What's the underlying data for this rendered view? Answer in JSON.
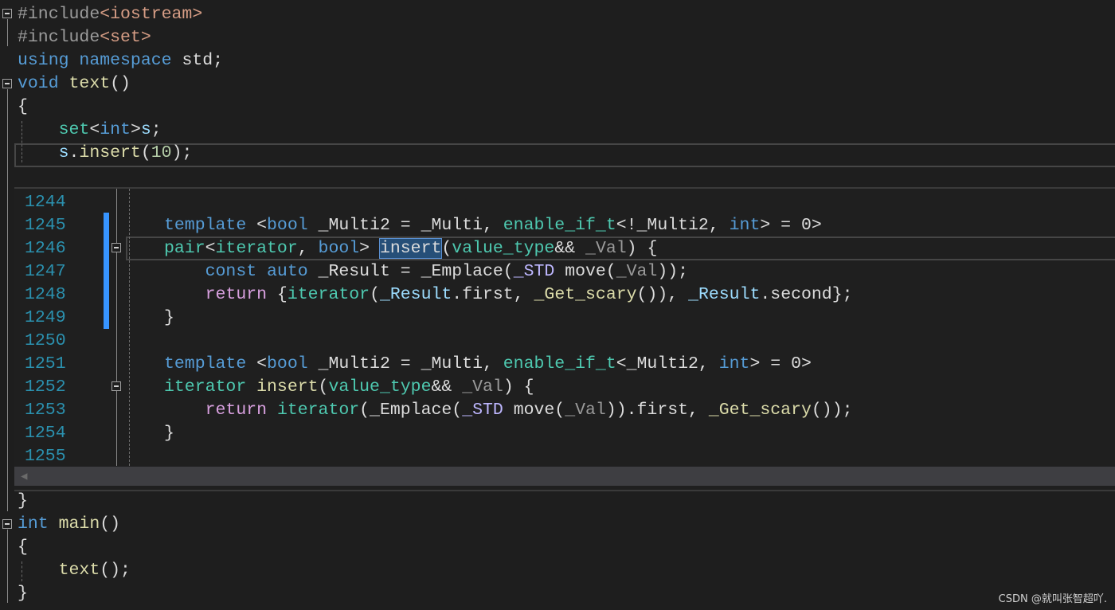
{
  "editor": {
    "main_lines_top": [
      [
        [
          "#include",
          "pre"
        ],
        [
          "<iostream>",
          "str"
        ]
      ],
      [
        [
          "#include",
          "pre"
        ],
        [
          "<set>",
          "str"
        ]
      ],
      [
        [
          "using",
          "kw"
        ],
        [
          " ",
          "plain"
        ],
        [
          "namespace",
          "kw"
        ],
        [
          " std;",
          "plain"
        ]
      ],
      [
        [
          "void",
          "kw"
        ],
        [
          " ",
          "plain"
        ],
        [
          "text",
          "fn"
        ],
        [
          "()",
          "plain"
        ]
      ],
      [
        [
          "{",
          "plain"
        ]
      ],
      [
        [
          "    ",
          "plain"
        ],
        [
          "set",
          "type"
        ],
        [
          "<",
          "plain"
        ],
        [
          "int",
          "kw"
        ],
        [
          ">",
          "plain"
        ],
        [
          "s",
          "var"
        ],
        [
          ";",
          "plain"
        ]
      ],
      [
        [
          "    ",
          "plain"
        ],
        [
          "s",
          "var"
        ],
        [
          ".",
          "plain"
        ],
        [
          "insert",
          "fn"
        ],
        [
          "(",
          "plain"
        ],
        [
          "10",
          "num"
        ],
        [
          ");",
          "plain"
        ]
      ]
    ],
    "main_lines_bottom": [
      [
        [
          "}",
          "plain"
        ]
      ],
      [
        [
          "int",
          "kw"
        ],
        [
          " ",
          "plain"
        ],
        [
          "main",
          "fn"
        ],
        [
          "()",
          "plain"
        ]
      ],
      [
        [
          "{",
          "plain"
        ]
      ],
      [
        [
          "    ",
          "plain"
        ],
        [
          "text",
          "fn"
        ],
        [
          "();",
          "plain"
        ]
      ],
      [
        [
          "}",
          "plain"
        ]
      ]
    ]
  },
  "peek": {
    "line_numbers": [
      "1244",
      "1245",
      "1246",
      "1247",
      "1248",
      "1249",
      "1250",
      "1251",
      "1252",
      "1253",
      "1254",
      "1255"
    ],
    "lines": [
      [],
      [
        [
          "template",
          "kw"
        ],
        [
          " <",
          "plain"
        ],
        [
          "bool",
          "kw"
        ],
        [
          " _Multi2 = _Multi, ",
          "plain"
        ],
        [
          "enable_if_t",
          "type"
        ],
        [
          "<!_Multi2, ",
          "plain"
        ],
        [
          "int",
          "kw"
        ],
        [
          "> = 0>",
          "plain"
        ]
      ],
      [
        [
          "pair",
          "type"
        ],
        [
          "<",
          "plain"
        ],
        [
          "iterator",
          "type"
        ],
        [
          ", ",
          "plain"
        ],
        [
          "bool",
          "kw"
        ],
        [
          "> ",
          "plain"
        ],
        [
          "insert",
          "sel"
        ],
        [
          "(",
          "plain"
        ],
        [
          "value_type",
          "type"
        ],
        [
          "&& ",
          "plain"
        ],
        [
          "_Val",
          "param"
        ],
        [
          ") {",
          "plain"
        ]
      ],
      [
        [
          "    ",
          "plain"
        ],
        [
          "const",
          "kw"
        ],
        [
          " ",
          "plain"
        ],
        [
          "auto",
          "kw"
        ],
        [
          " _Result = _Emplace(",
          "plain"
        ],
        [
          "_STD",
          "macro"
        ],
        [
          " move(",
          "plain"
        ],
        [
          "_Val",
          "param"
        ],
        [
          "));",
          "plain"
        ]
      ],
      [
        [
          "    ",
          "plain"
        ],
        [
          "return",
          "ctrl"
        ],
        [
          " {",
          "plain"
        ],
        [
          "iterator",
          "type"
        ],
        [
          "(",
          "plain"
        ],
        [
          "_Result",
          "var"
        ],
        [
          ".first, ",
          "plain"
        ],
        [
          "_Get_scary",
          "fn"
        ],
        [
          "()), ",
          "plain"
        ],
        [
          "_Result",
          "var"
        ],
        [
          ".second};",
          "plain"
        ]
      ],
      [
        [
          "}",
          "plain"
        ]
      ],
      [],
      [
        [
          "template",
          "kw"
        ],
        [
          " <",
          "plain"
        ],
        [
          "bool",
          "kw"
        ],
        [
          " _Multi2 = _Multi, ",
          "plain"
        ],
        [
          "enable_if_t",
          "type"
        ],
        [
          "<_Multi2, ",
          "plain"
        ],
        [
          "int",
          "kw"
        ],
        [
          "> = 0>",
          "plain"
        ]
      ],
      [
        [
          "iterator",
          "type"
        ],
        [
          " ",
          "plain"
        ],
        [
          "insert",
          "fn"
        ],
        [
          "(",
          "plain"
        ],
        [
          "value_type",
          "type"
        ],
        [
          "&& ",
          "plain"
        ],
        [
          "_Val",
          "param"
        ],
        [
          ") {",
          "plain"
        ]
      ],
      [
        [
          "    ",
          "plain"
        ],
        [
          "return",
          "ctrl"
        ],
        [
          " ",
          "plain"
        ],
        [
          "iterator",
          "type"
        ],
        [
          "(_Emplace(",
          "plain"
        ],
        [
          "_STD",
          "macro"
        ],
        [
          " move(",
          "plain"
        ],
        [
          "_Val",
          "param"
        ],
        [
          ")).first, ",
          "plain"
        ],
        [
          "_Get_scary",
          "fn"
        ],
        [
          "());",
          "plain"
        ]
      ],
      [
        [
          "}",
          "plain"
        ]
      ],
      []
    ]
  },
  "watermark": "CSDN @就叫张智超吖.",
  "colors": {
    "keyword": "#569cd6",
    "type": "#4ec9b0",
    "function": "#dcdcaa",
    "string": "#d69d85",
    "variable": "#9cdcfe",
    "control": "#d8a0df",
    "change_bar": "#3794ff",
    "selection": "#264f78"
  }
}
